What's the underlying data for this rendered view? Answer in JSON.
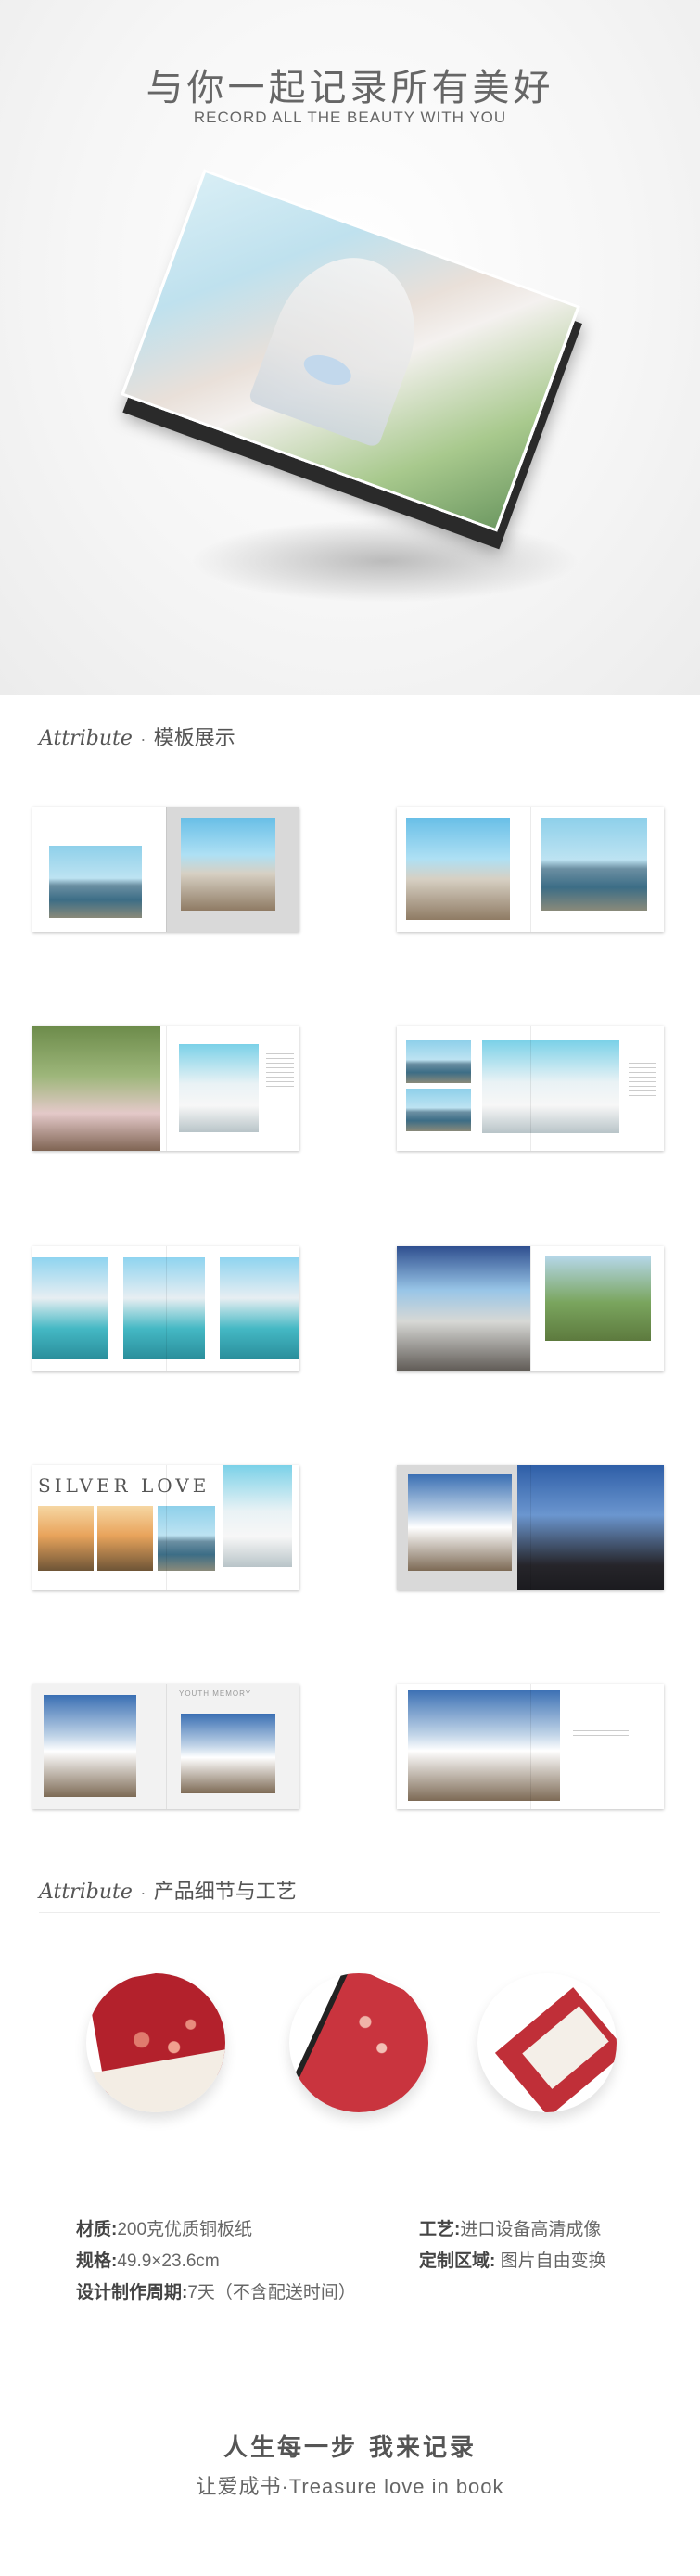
{
  "hero": {
    "title": "与你一起记录所有美好",
    "subtitle": "RECORD ALL THE BEAUTY WITH YOU"
  },
  "section1": {
    "en": "Attribute",
    "dot": "·",
    "cn": "模板展示"
  },
  "section2": {
    "en": "Attribute",
    "dot": "·",
    "cn": "产品细节与工艺"
  },
  "templates": {
    "silver_love": "SILVER  LOVE",
    "youth_memory": "YOUTH MEMORY"
  },
  "specs": {
    "material_label": "材质:",
    "material_value": "200克优质铜板纸",
    "process_label": "工艺:",
    "process_value": "进口设备高清成像",
    "size_label": "规格:",
    "size_value": "49.9×23.6cm",
    "custom_label": "定制区域:",
    "custom_value": " 图片自由变换",
    "period_label": "设计制作周期:",
    "period_value": "7天（不含配送时间）"
  },
  "footer": {
    "title": "人生每一步 我来记录",
    "subtitle": "让爱成书·Treasure love in book"
  }
}
